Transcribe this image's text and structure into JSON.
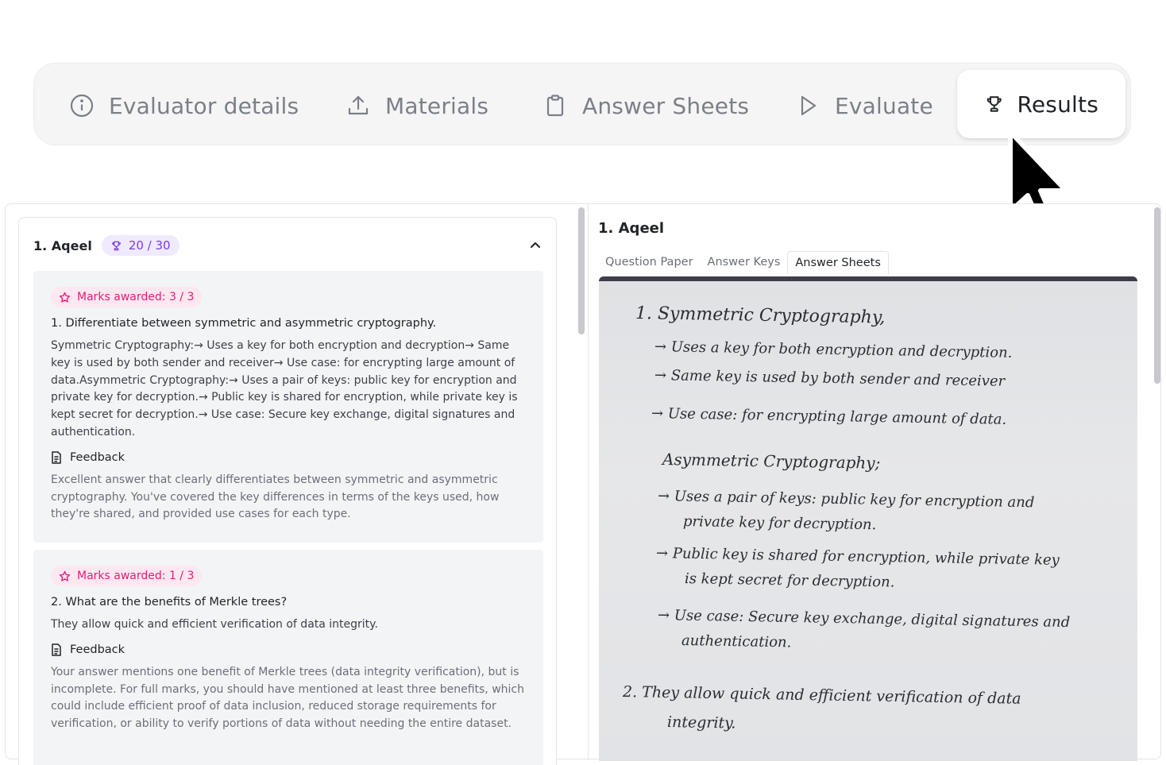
{
  "tabs": [
    {
      "label": "Evaluator details",
      "icon": "info-icon"
    },
    {
      "label": "Materials",
      "icon": "upload-icon"
    },
    {
      "label": "Answer Sheets",
      "icon": "clipboard-icon"
    },
    {
      "label": "Evaluate",
      "icon": "play-icon"
    },
    {
      "label": "Results",
      "icon": "trophy-icon",
      "active": true
    }
  ],
  "left": {
    "student": "1. Aqeel",
    "score": "20 / 30",
    "questions": [
      {
        "marks": "Marks awarded: 3 / 3",
        "title": "1. Differentiate between symmetric and asymmetric cryptography.",
        "answer": "Symmetric Cryptography:→ Uses a key for both encryption and decryption→ Same key is used by both sender and receiver→ Use case: for encrypting large amount of data.Asymmetric Cryptography:→ Uses a pair of keys: public key for encryption and private key for decryption.→ Public key is shared for encryption, while private key is kept secret for decryption.→ Use case: Secure key exchange, digital signatures and authentication.",
        "feedback_label": "Feedback",
        "feedback": "Excellent answer that clearly differentiates between symmetric and asymmetric cryptography. You've covered the key differences in terms of the keys used, how they're shared, and provided use cases for each type."
      },
      {
        "marks": "Marks awarded: 1 / 3",
        "title": "2. What are the benefits of Merkle trees?",
        "answer": "They allow quick and efficient verification of data integrity.",
        "feedback_label": "Feedback",
        "feedback": "Your answer mentions one benefit of Merkle trees (data integrity verification), but is incomplete. For full marks, you should have mentioned at least three benefits, which could include efficient proof of data inclusion, reduced storage requirements for verification, or ability to verify portions of data without needing the entire dataset."
      }
    ]
  },
  "right": {
    "student": "1. Aqeel",
    "subtabs": [
      "Question Paper",
      "Answer Keys",
      "Answer Sheets"
    ],
    "active_subtab": "Answer Sheets",
    "handwriting": [
      "1.  Symmetric Cryptography,",
      "→  Uses a key for both encryption and decryption.",
      "→  Same key is used by both sender and receiver",
      "→  Use case: for encrypting large amount of data.",
      "Asymmetric Cryptography;",
      "→  Uses a pair of keys: public key for encryption and",
      "private key for decryption.",
      "→  Public key is shared for encryption, while private key",
      "is kept secret for decryption.",
      "→  Use case: Secure key exchange, digital signatures and",
      "authentication.",
      "2.   They allow quick and efficient verification of data",
      "integrity."
    ]
  }
}
